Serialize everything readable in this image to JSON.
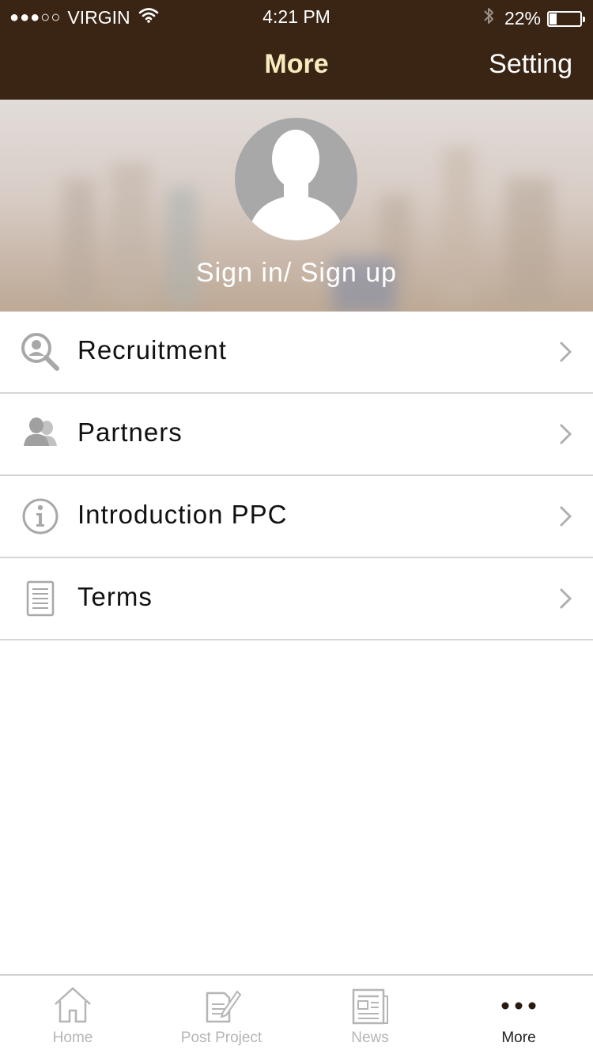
{
  "status_bar": {
    "signal_dots": "●●●○○",
    "carrier": "VIRGIN",
    "time": "4:21 PM",
    "battery_percent": "22%",
    "battery_level": 0.22
  },
  "nav": {
    "title": "More",
    "right_label": "Setting"
  },
  "banner": {
    "signin_text": "Sign in/ Sign up",
    "avatar_icon": "user-silhouette-icon"
  },
  "menu": {
    "items": [
      {
        "label": "Recruitment",
        "icon": "search-person-icon"
      },
      {
        "label": "Partners",
        "icon": "people-icon"
      },
      {
        "label": "Introduction PPC",
        "icon": "info-icon"
      },
      {
        "label": "Terms",
        "icon": "document-icon"
      }
    ]
  },
  "tabbar": {
    "tabs": [
      {
        "label": "Home",
        "icon": "home-icon"
      },
      {
        "label": "Post Project",
        "icon": "edit-document-icon"
      },
      {
        "label": "News",
        "icon": "newspaper-icon"
      },
      {
        "label": "More",
        "icon": "more-dots-icon"
      }
    ],
    "active_tab": "More"
  },
  "colors": {
    "nav_background": "#3a2515",
    "nav_title": "#f8ecbe",
    "active_tab": "#222222",
    "inactive_tab": "#b5b5b5"
  }
}
